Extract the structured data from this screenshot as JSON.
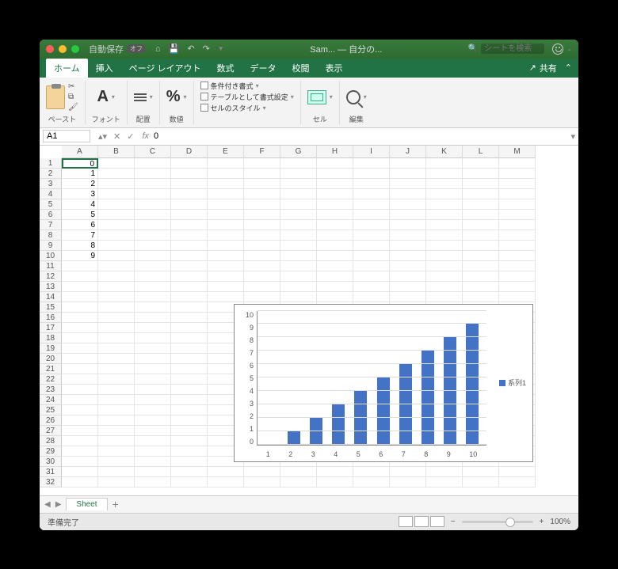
{
  "titlebar": {
    "autosave": "自動保存",
    "autosave_state": "オフ",
    "filename": "Sam... — 自分の...",
    "search_placeholder": "シートを検索"
  },
  "tabs": {
    "home": "ホーム",
    "insert": "挿入",
    "page_layout": "ページ レイアウト",
    "formulas": "数式",
    "data": "データ",
    "review": "校閲",
    "view": "表示",
    "share": "共有"
  },
  "ribbon": {
    "paste": "ペースト",
    "font": "フォント",
    "alignment": "配置",
    "number": "数値",
    "cond_format": "条件付き書式",
    "table_format": "テーブルとして書式設定",
    "cell_styles": "セルのスタイル",
    "cells": "セル",
    "editing": "編集"
  },
  "formula_bar": {
    "cell_ref": "A1",
    "value": "0"
  },
  "columns": [
    "A",
    "B",
    "C",
    "D",
    "E",
    "F",
    "G",
    "H",
    "I",
    "J",
    "K",
    "L",
    "M"
  ],
  "rows": [
    1,
    2,
    3,
    4,
    5,
    6,
    7,
    8,
    9,
    10,
    11,
    12,
    13,
    14,
    15,
    16,
    17,
    18,
    19,
    20,
    21,
    22,
    23,
    24,
    25,
    26,
    27,
    28,
    29,
    30,
    31,
    32
  ],
  "colA_values": [
    0,
    1,
    2,
    3,
    4,
    5,
    6,
    7,
    8,
    9
  ],
  "chart_data": {
    "type": "bar",
    "categories": [
      1,
      2,
      3,
      4,
      5,
      6,
      7,
      8,
      9,
      10
    ],
    "values": [
      0,
      1,
      2,
      3,
      4,
      5,
      6,
      7,
      8,
      9
    ],
    "y_ticks": [
      0,
      1,
      2,
      3,
      4,
      5,
      6,
      7,
      8,
      9,
      10
    ],
    "ylim": [
      0,
      10
    ],
    "legend": "系列1"
  },
  "sheet_tab": "Sheet",
  "status": {
    "ready": "準備完了",
    "zoom": "100%"
  }
}
